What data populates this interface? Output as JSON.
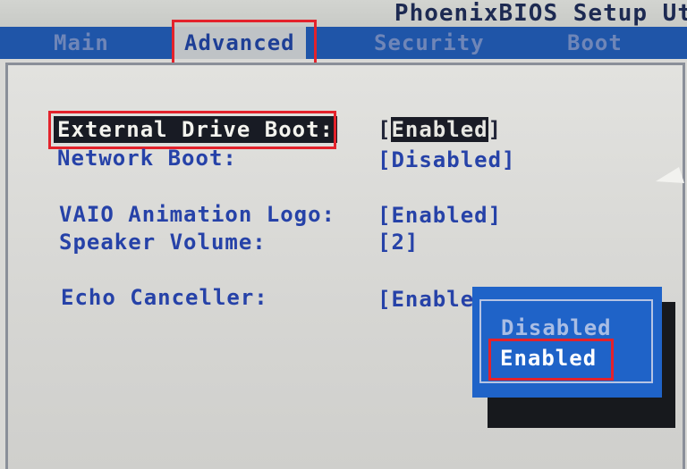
{
  "header": {
    "title": "PhoenixBIOS Setup Ut"
  },
  "menu": {
    "tabs": [
      {
        "label": "Main"
      },
      {
        "label": "Advanced"
      },
      {
        "label": "Security"
      },
      {
        "label": "Boot"
      }
    ],
    "active": "Advanced"
  },
  "settings": [
    {
      "label": "External Drive Boot:",
      "value": "Enabled"
    },
    {
      "label": "Network Boot:",
      "value": "[Disabled]"
    },
    {
      "label": "VAIO Animation Logo:",
      "value": "[Enabled]"
    },
    {
      "label": "Speaker Volume:",
      "value": "[2]"
    },
    {
      "label": "Echo Canceller:",
      "value": "[Enable"
    }
  ],
  "popup": {
    "options": [
      {
        "label": "Disabled"
      },
      {
        "label": "Enabled"
      }
    ],
    "selected": "Enabled"
  },
  "colors": {
    "menu_bar": "#1f55a8",
    "text_blue": "#2642a8",
    "popup_blue": "#1f63c8",
    "highlight_red": "#e3222b"
  }
}
